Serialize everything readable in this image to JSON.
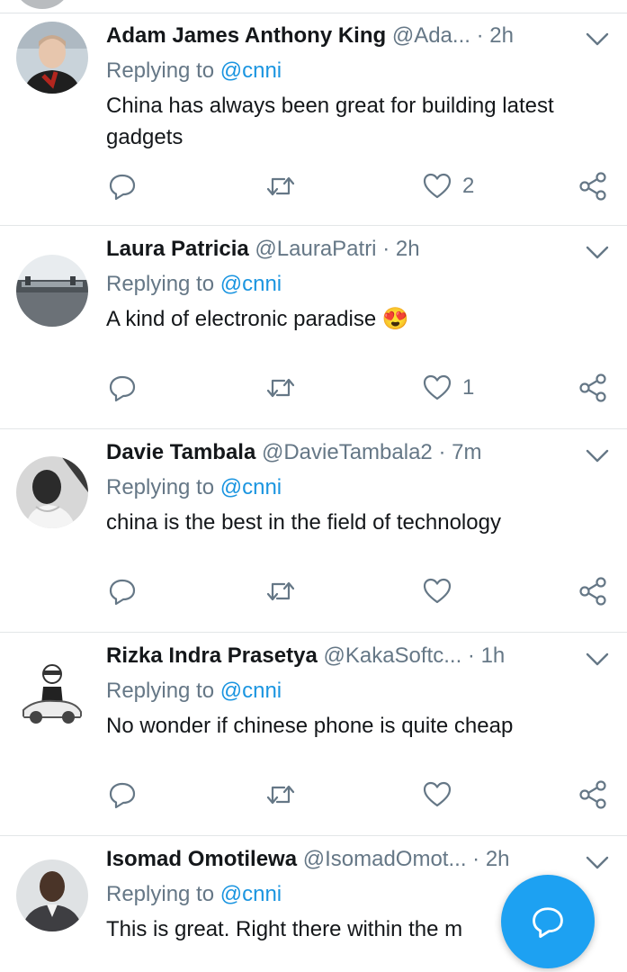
{
  "tweets": [
    {
      "name": "Adam James Anthony King",
      "handle": "@Ada...",
      "time": "2h",
      "replying_label": "Replying to",
      "replying_to": "@cnni",
      "text": "China has always been great for building latest gadgets",
      "like_count": "2"
    },
    {
      "name": "Laura Patricia",
      "handle": "@LauraPatri",
      "time": "2h",
      "replying_label": "Replying to",
      "replying_to": "@cnni",
      "text": "A kind of electronic paradise",
      "emoji": "😍",
      "like_count": "1"
    },
    {
      "name": "Davie Tambala",
      "handle": "@DavieTambala2",
      "time": "7m",
      "replying_label": "Replying to",
      "replying_to": "@cnni",
      "text": "china is the best in the field of technology",
      "like_count": ""
    },
    {
      "name": "Rizka Indra Prasetya",
      "handle": "@KakaSoftc...",
      "time": "1h",
      "replying_label": "Replying to",
      "replying_to": "@cnni",
      "text": "No wonder if chinese phone is quite cheap",
      "like_count": ""
    },
    {
      "name": "Isomad Omotilewa",
      "handle": "@IsomadOmot...",
      "time": "2h",
      "replying_label": "Replying to",
      "replying_to": "@cnni",
      "text": "This is great. Right there within the m",
      "like_count": ""
    }
  ],
  "separator": "·",
  "icons": {
    "reply": "reply-icon",
    "retweet": "retweet-icon",
    "like": "heart-icon",
    "share": "share-icon",
    "more": "chevron-down-icon",
    "compose": "compose-reply-icon"
  },
  "colors": {
    "accent": "#1da1f2",
    "mention": "#1b95e0",
    "secondary_text": "#657786",
    "icon": "#657786"
  }
}
